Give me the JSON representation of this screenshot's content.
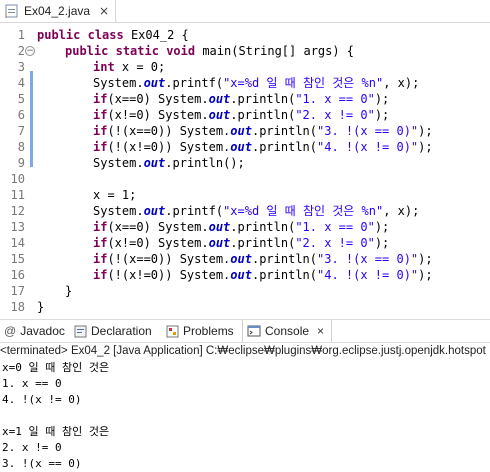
{
  "editor_tab": {
    "title": "Ex04_2.java",
    "close_glyph": "×"
  },
  "code": {
    "lines": [
      {
        "num": "1",
        "text": "public class Ex04_2 {"
      },
      {
        "num": "2",
        "text": "public static void main(String[] args) {"
      },
      {
        "num": "3",
        "text": "int x = 0;"
      },
      {
        "num": "4",
        "text": "System.out.printf(\"x=%d 일 때 참인 것은 %n\", x);"
      },
      {
        "num": "5",
        "text": "if(x==0) System.out.println(\"1. x == 0\");"
      },
      {
        "num": "6",
        "text": "if(x!=0) System.out.println(\"2. x != 0\");"
      },
      {
        "num": "7",
        "text": "if(!(x==0)) System.out.println(\"3. !(x == 0)\");"
      },
      {
        "num": "8",
        "text": "if(!(x!=0)) System.out.println(\"4. !(x != 0)\");"
      },
      {
        "num": "9",
        "text": "System.out.println();"
      },
      {
        "num": "10",
        "text": ""
      },
      {
        "num": "11",
        "text": "x = 1;"
      },
      {
        "num": "12",
        "text": "System.out.printf(\"x=%d 일 때 참인 것은 %n\", x);"
      },
      {
        "num": "13",
        "text": "if(x==0) System.out.println(\"1. x == 0\");"
      },
      {
        "num": "14",
        "text": "if(x!=0) System.out.println(\"2. x != 0\");"
      },
      {
        "num": "15",
        "text": "if(!(x==0)) System.out.println(\"3. !(x == 0)\");"
      },
      {
        "num": "16",
        "text": "if(!(x!=0)) System.out.println(\"4. !(x != 0)\");"
      },
      {
        "num": "17",
        "text": "}"
      },
      {
        "num": "18",
        "text": "}"
      }
    ],
    "colors": {
      "keyword": "#7f0055",
      "field": "#0000c0",
      "string": "#2a00ff",
      "line_number": "#787878"
    }
  },
  "views": {
    "tabs": [
      {
        "label": "Javadoc",
        "icon": "at-icon"
      },
      {
        "label": "Declaration",
        "icon": "declaration-icon"
      },
      {
        "label": "Problems",
        "icon": "problems-icon"
      },
      {
        "label": "Console",
        "icon": "console-icon",
        "active": true,
        "close_glyph": "×"
      }
    ]
  },
  "console": {
    "header": "<terminated> Ex04_2 [Java Application] C:₩eclipse₩plugins₩org.eclipse.justj.openjdk.hotspot",
    "output": [
      "x=0 일 때 참인 것은",
      "1. x == 0",
      "4. !(x != 0)",
      "",
      "x=1 일 때 참인 것은",
      "2. x != 0",
      "3. !(x == 0)"
    ]
  }
}
